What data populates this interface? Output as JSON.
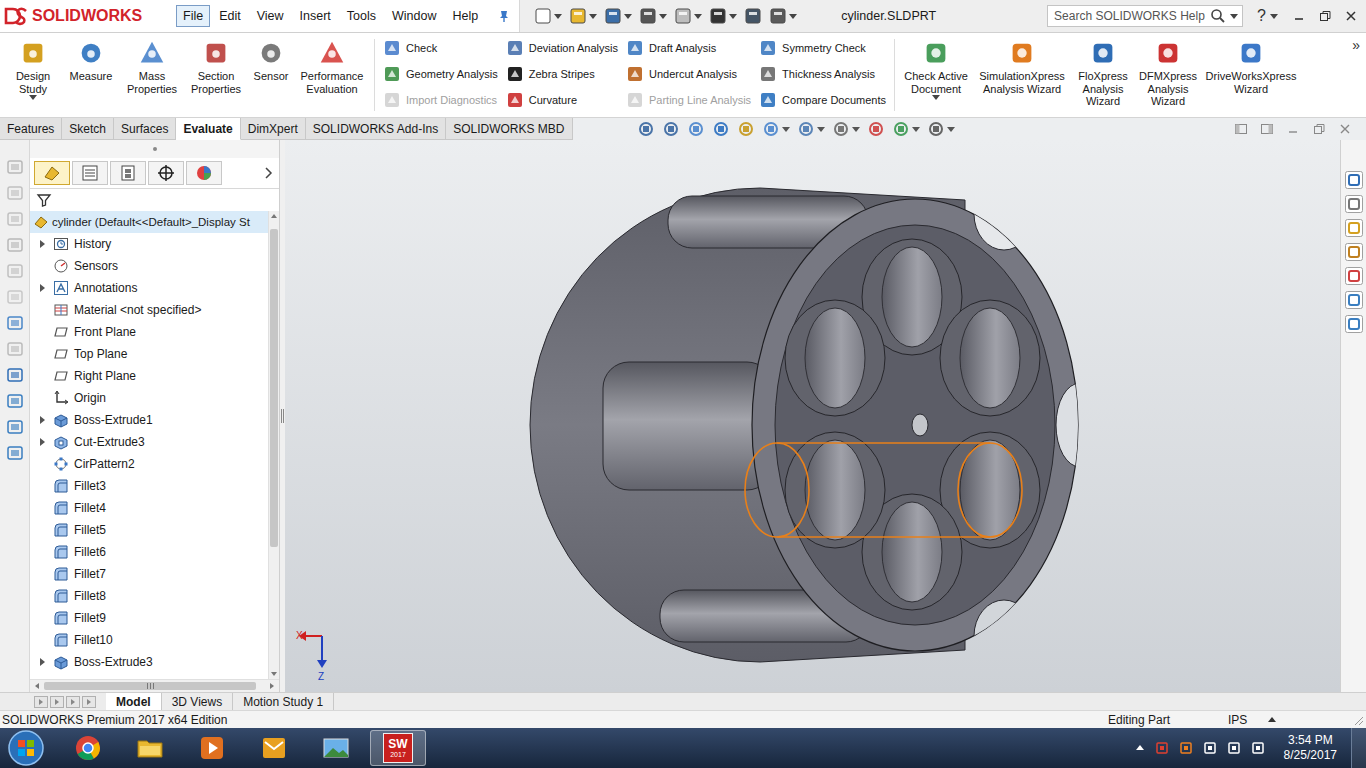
{
  "app": {
    "logo": "SOLIDWORKS",
    "document_title": "cylinder.SLDPRT",
    "search_placeholder": "Search SOLIDWORKS Help",
    "help": "?"
  },
  "menu": [
    {
      "label": "File",
      "selected": true
    },
    {
      "label": "Edit",
      "selected": false
    },
    {
      "label": "View",
      "selected": false
    },
    {
      "label": "Insert",
      "selected": false
    },
    {
      "label": "Tools",
      "selected": false
    },
    {
      "label": "Window",
      "selected": false
    },
    {
      "label": "Help",
      "selected": false
    }
  ],
  "ribbon": {
    "left_buttons": [
      {
        "label": "Design Study",
        "dropdown": true
      },
      {
        "label": "Measure",
        "dropdown": false
      },
      {
        "label": "Mass Properties",
        "dropdown": false
      },
      {
        "label": "Section Properties",
        "dropdown": false
      },
      {
        "label": "Sensor",
        "dropdown": false
      },
      {
        "label": "Performance Evaluation",
        "dropdown": false
      }
    ],
    "groups": [
      [
        {
          "label": "Check",
          "disabled": false
        },
        {
          "label": "Geometry Analysis",
          "disabled": false
        },
        {
          "label": "Import Diagnostics",
          "disabled": true
        }
      ],
      [
        {
          "label": "Deviation Analysis",
          "disabled": false
        },
        {
          "label": "Zebra Stripes",
          "disabled": false
        },
        {
          "label": "Curvature",
          "disabled": false
        }
      ],
      [
        {
          "label": "Draft Analysis",
          "disabled": false
        },
        {
          "label": "Undercut Analysis",
          "disabled": false
        },
        {
          "label": "Parting Line Analysis",
          "disabled": true
        }
      ],
      [
        {
          "label": "Symmetry Check",
          "disabled": false
        },
        {
          "label": "Thickness Analysis",
          "disabled": false
        },
        {
          "label": "Compare Documents",
          "disabled": false
        }
      ]
    ],
    "right_buttons": [
      {
        "label": "Check Active Document",
        "dropdown": true
      },
      {
        "label": "SimulationXpress Analysis Wizard",
        "dropdown": false
      },
      {
        "label": "FloXpress Analysis Wizard",
        "dropdown": false
      },
      {
        "label": "DFMXpress Analysis Wizard",
        "dropdown": false
      },
      {
        "label": "DriveWorksXpress Wizard",
        "dropdown": false
      }
    ],
    "more": "»"
  },
  "command_tabs": [
    {
      "label": "Features",
      "selected": false
    },
    {
      "label": "Sketch",
      "selected": false
    },
    {
      "label": "Surfaces",
      "selected": false
    },
    {
      "label": "Evaluate",
      "selected": true
    },
    {
      "label": "DimXpert",
      "selected": false
    },
    {
      "label": "SOLIDWORKS Add-Ins",
      "selected": false
    },
    {
      "label": "SOLIDWORKS MBD",
      "selected": false
    }
  ],
  "panel_tabs": [
    {
      "kind": "feature-manager",
      "selected": true
    },
    {
      "kind": "property-manager",
      "selected": false
    },
    {
      "kind": "configuration-manager",
      "selected": false
    },
    {
      "kind": "dimxpert-manager",
      "selected": false
    },
    {
      "kind": "display-manager",
      "selected": false
    }
  ],
  "feature_tree": {
    "root": {
      "label": "cylinder  (Default<<Default>_Display St",
      "selected": true
    },
    "items": [
      {
        "label": "History",
        "kind": "history",
        "expandable": true
      },
      {
        "label": "Sensors",
        "kind": "sensors",
        "expandable": false
      },
      {
        "label": "Annotations",
        "kind": "annotations",
        "expandable": true
      },
      {
        "label": "Material <not specified>",
        "kind": "material",
        "expandable": false
      },
      {
        "label": "Front Plane",
        "kind": "plane",
        "expandable": false
      },
      {
        "label": "Top Plane",
        "kind": "plane",
        "expandable": false
      },
      {
        "label": "Right Plane",
        "kind": "plane",
        "expandable": false
      },
      {
        "label": "Origin",
        "kind": "origin",
        "expandable": false
      },
      {
        "label": "Boss-Extrude1",
        "kind": "extrude",
        "expandable": true
      },
      {
        "label": "Cut-Extrude3",
        "kind": "cut",
        "expandable": true
      },
      {
        "label": "CirPattern2",
        "kind": "pattern",
        "expandable": false
      },
      {
        "label": "Fillet3",
        "kind": "fillet",
        "expandable": false
      },
      {
        "label": "Fillet4",
        "kind": "fillet",
        "expandable": false
      },
      {
        "label": "Fillet5",
        "kind": "fillet",
        "expandable": false
      },
      {
        "label": "Fillet6",
        "kind": "fillet",
        "expandable": false
      },
      {
        "label": "Fillet7",
        "kind": "fillet",
        "expandable": false
      },
      {
        "label": "Fillet8",
        "kind": "fillet",
        "expandable": false
      },
      {
        "label": "Fillet9",
        "kind": "fillet",
        "expandable": false
      },
      {
        "label": "Fillet10",
        "kind": "fillet",
        "expandable": false
      },
      {
        "label": "Boss-Extrude3",
        "kind": "extrude",
        "expandable": true
      }
    ]
  },
  "bottom_tabs": [
    {
      "label": "Model",
      "selected": true
    },
    {
      "label": "3D Views",
      "selected": false
    },
    {
      "label": "Motion Study 1",
      "selected": false
    }
  ],
  "status_bar": {
    "edition": "SOLIDWORKS Premium 2017 x64 Edition",
    "mode": "Editing Part",
    "units": "IPS"
  },
  "triad": {
    "x": "X",
    "z": "Z"
  },
  "taskbar": {
    "apps": [
      {
        "kind": "chrome",
        "active": false
      },
      {
        "kind": "explorer",
        "active": false
      },
      {
        "kind": "media",
        "active": false
      },
      {
        "kind": "outlook",
        "active": false
      },
      {
        "kind": "photos",
        "active": false
      },
      {
        "kind": "solidworks",
        "active": true,
        "label": "SW",
        "version": "2017"
      }
    ],
    "time": "3:54 PM",
    "date": "8/25/2017"
  }
}
